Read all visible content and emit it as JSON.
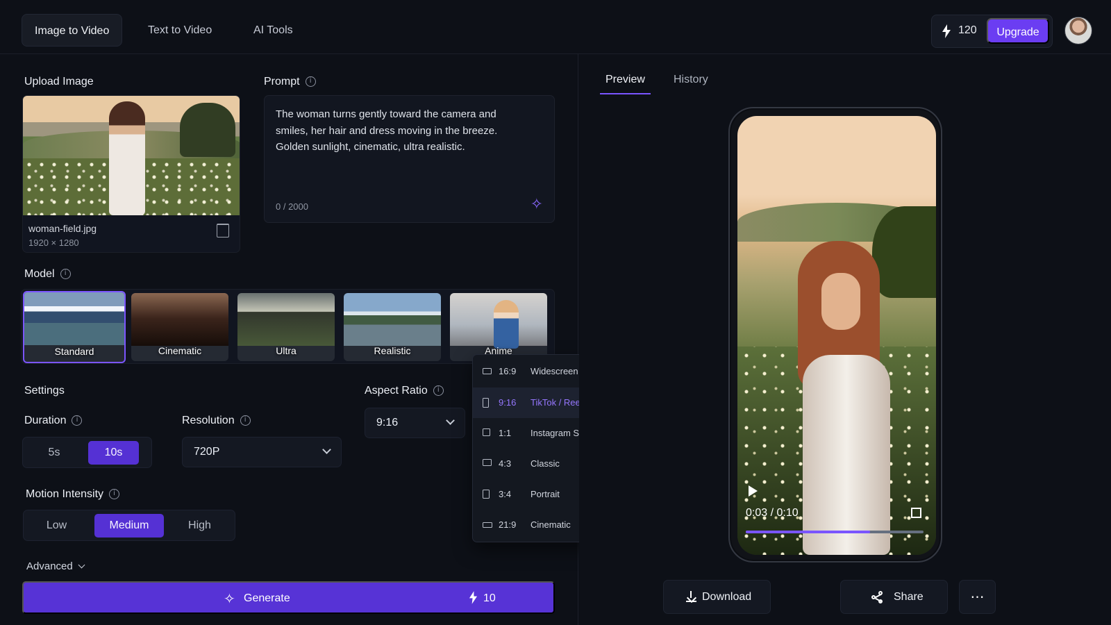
{
  "topbar": {
    "tabs": [
      "Image to Video",
      "Text to Video",
      "AI Tools"
    ],
    "credits": "120",
    "upgrade_label": "Upgrade"
  },
  "upload": {
    "label": "Upload Image",
    "filename": "woman-field.jpg",
    "dimensions": "1920 × 1280"
  },
  "prompt": {
    "label": "Prompt",
    "text": "The woman turns gently toward the camera and smiles, her hair and dress moving in the breeze. Golden sunlight, cinematic, ultra realistic.",
    "counter": "0 / 2000"
  },
  "model": {
    "label": "Model",
    "options": [
      "Standard",
      "Cinematic",
      "Ultra",
      "Realistic",
      "Anime"
    ],
    "selected": "Standard"
  },
  "settings": {
    "label": "Settings",
    "duration": {
      "label": "Duration",
      "options": [
        "5s",
        "10s"
      ],
      "selected": "10s"
    },
    "resolution": {
      "label": "Resolution",
      "value": "720P"
    },
    "aspect_ratio": {
      "label": "Aspect Ratio",
      "value": "9:16"
    },
    "motion": {
      "label": "Motion Intensity",
      "options": [
        "Low",
        "Medium",
        "High"
      ],
      "selected": "Medium"
    },
    "advanced_label": "Advanced"
  },
  "aspect_dropdown": {
    "options": [
      {
        "ratio": "16:9",
        "name": "Widescreen"
      },
      {
        "ratio": "9:16",
        "name": "TikTok / Reels",
        "selected": true
      },
      {
        "ratio": "1:1",
        "name": "Instagram Square"
      },
      {
        "ratio": "4:3",
        "name": "Classic"
      },
      {
        "ratio": "3:4",
        "name": "Portrait"
      },
      {
        "ratio": "21:9",
        "name": "Cinematic"
      }
    ]
  },
  "generate": {
    "label": "Generate",
    "cost": "10"
  },
  "preview": {
    "tabs": [
      "Preview",
      "History"
    ],
    "time": "0:03 / 0:10",
    "progress": 0.7,
    "download_label": "Download",
    "share_label": "Share"
  },
  "icons": [
    "bolt-icon",
    "trash-icon",
    "info-icon",
    "sparkle-icon",
    "chevron-down-icon",
    "check-icon",
    "play-icon",
    "fullscreen-icon",
    "download-icon",
    "share-icon",
    "more-icon"
  ],
  "colors": {
    "accent": "#5733d6",
    "selected": "#7b55ff",
    "background": "#0d1017"
  }
}
